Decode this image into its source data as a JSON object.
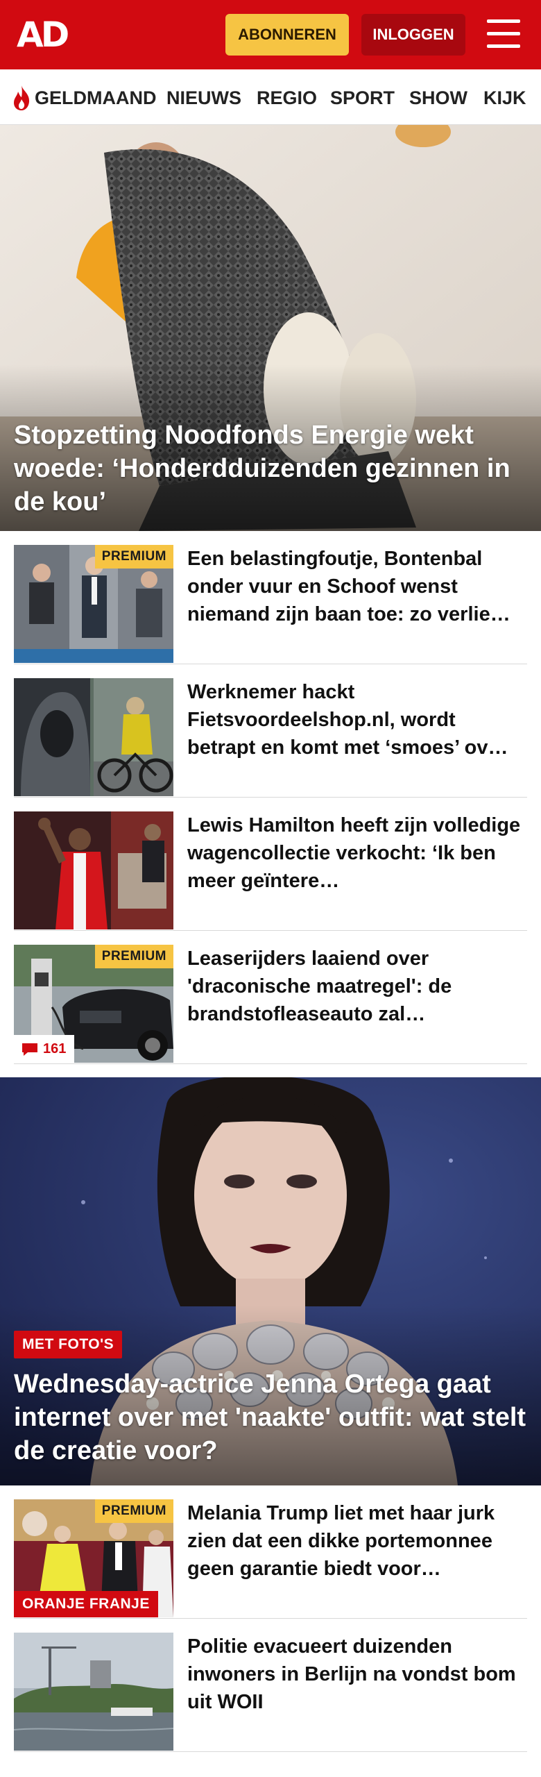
{
  "header": {
    "logo_text": "AD",
    "subscribe_label": "ABONNEREN",
    "login_label": "INLOGGEN",
    "menu_icon": "hamburger-menu-icon"
  },
  "nav": {
    "items": [
      {
        "label": "GELDMAAND",
        "icon": "flame-icon"
      },
      {
        "label": "NIEUWS"
      },
      {
        "label": "REGIO"
      },
      {
        "label": "SPORT"
      },
      {
        "label": "SHOW"
      },
      {
        "label": "KIJK"
      }
    ]
  },
  "hero": {
    "title": "Stopzetting Noodfonds Energie wekt woede: ‘Honderdduizenden gezinnen in de kou’"
  },
  "articles": [
    {
      "title": "Een belastingfoutje, Bontenbal onder vuur en Schoof wenst niemand zijn baan toe: zo verlie…",
      "badge": "PREMIUM"
    },
    {
      "title": "Werknemer hackt Fietsvoordeelshop.nl, wordt betrapt en komt met ‘smoes’ ov…"
    },
    {
      "title": "Lewis Hamilton heeft zijn volledige wagencollectie verkocht: ‘Ik ben meer geïntere…"
    },
    {
      "title": "Leaserijders laaiend over 'draconische maatregel': de brandstofleaseauto zal…",
      "badge": "PREMIUM",
      "comment_count": "161"
    }
  ],
  "feature": {
    "tag": "MET FOTO'S",
    "title": "Wednesday-actrice Jenna Ortega gaat internet over met 'naakte' outfit: wat stelt de creatie voor?"
  },
  "articles_more": [
    {
      "title": "Melania Trump liet met haar jurk zien dat een dikke portemonnee geen garantie biedt voor…",
      "badge": "PREMIUM",
      "label": "ORANJE FRANJE"
    },
    {
      "title": "Politie evacueert duizenden inwoners in Berlijn na vondst bom uit WOII"
    }
  ],
  "colors": {
    "brand_red": "#d10a11",
    "premium_yellow": "#f6c443",
    "login_dark_red": "#a8080f"
  }
}
